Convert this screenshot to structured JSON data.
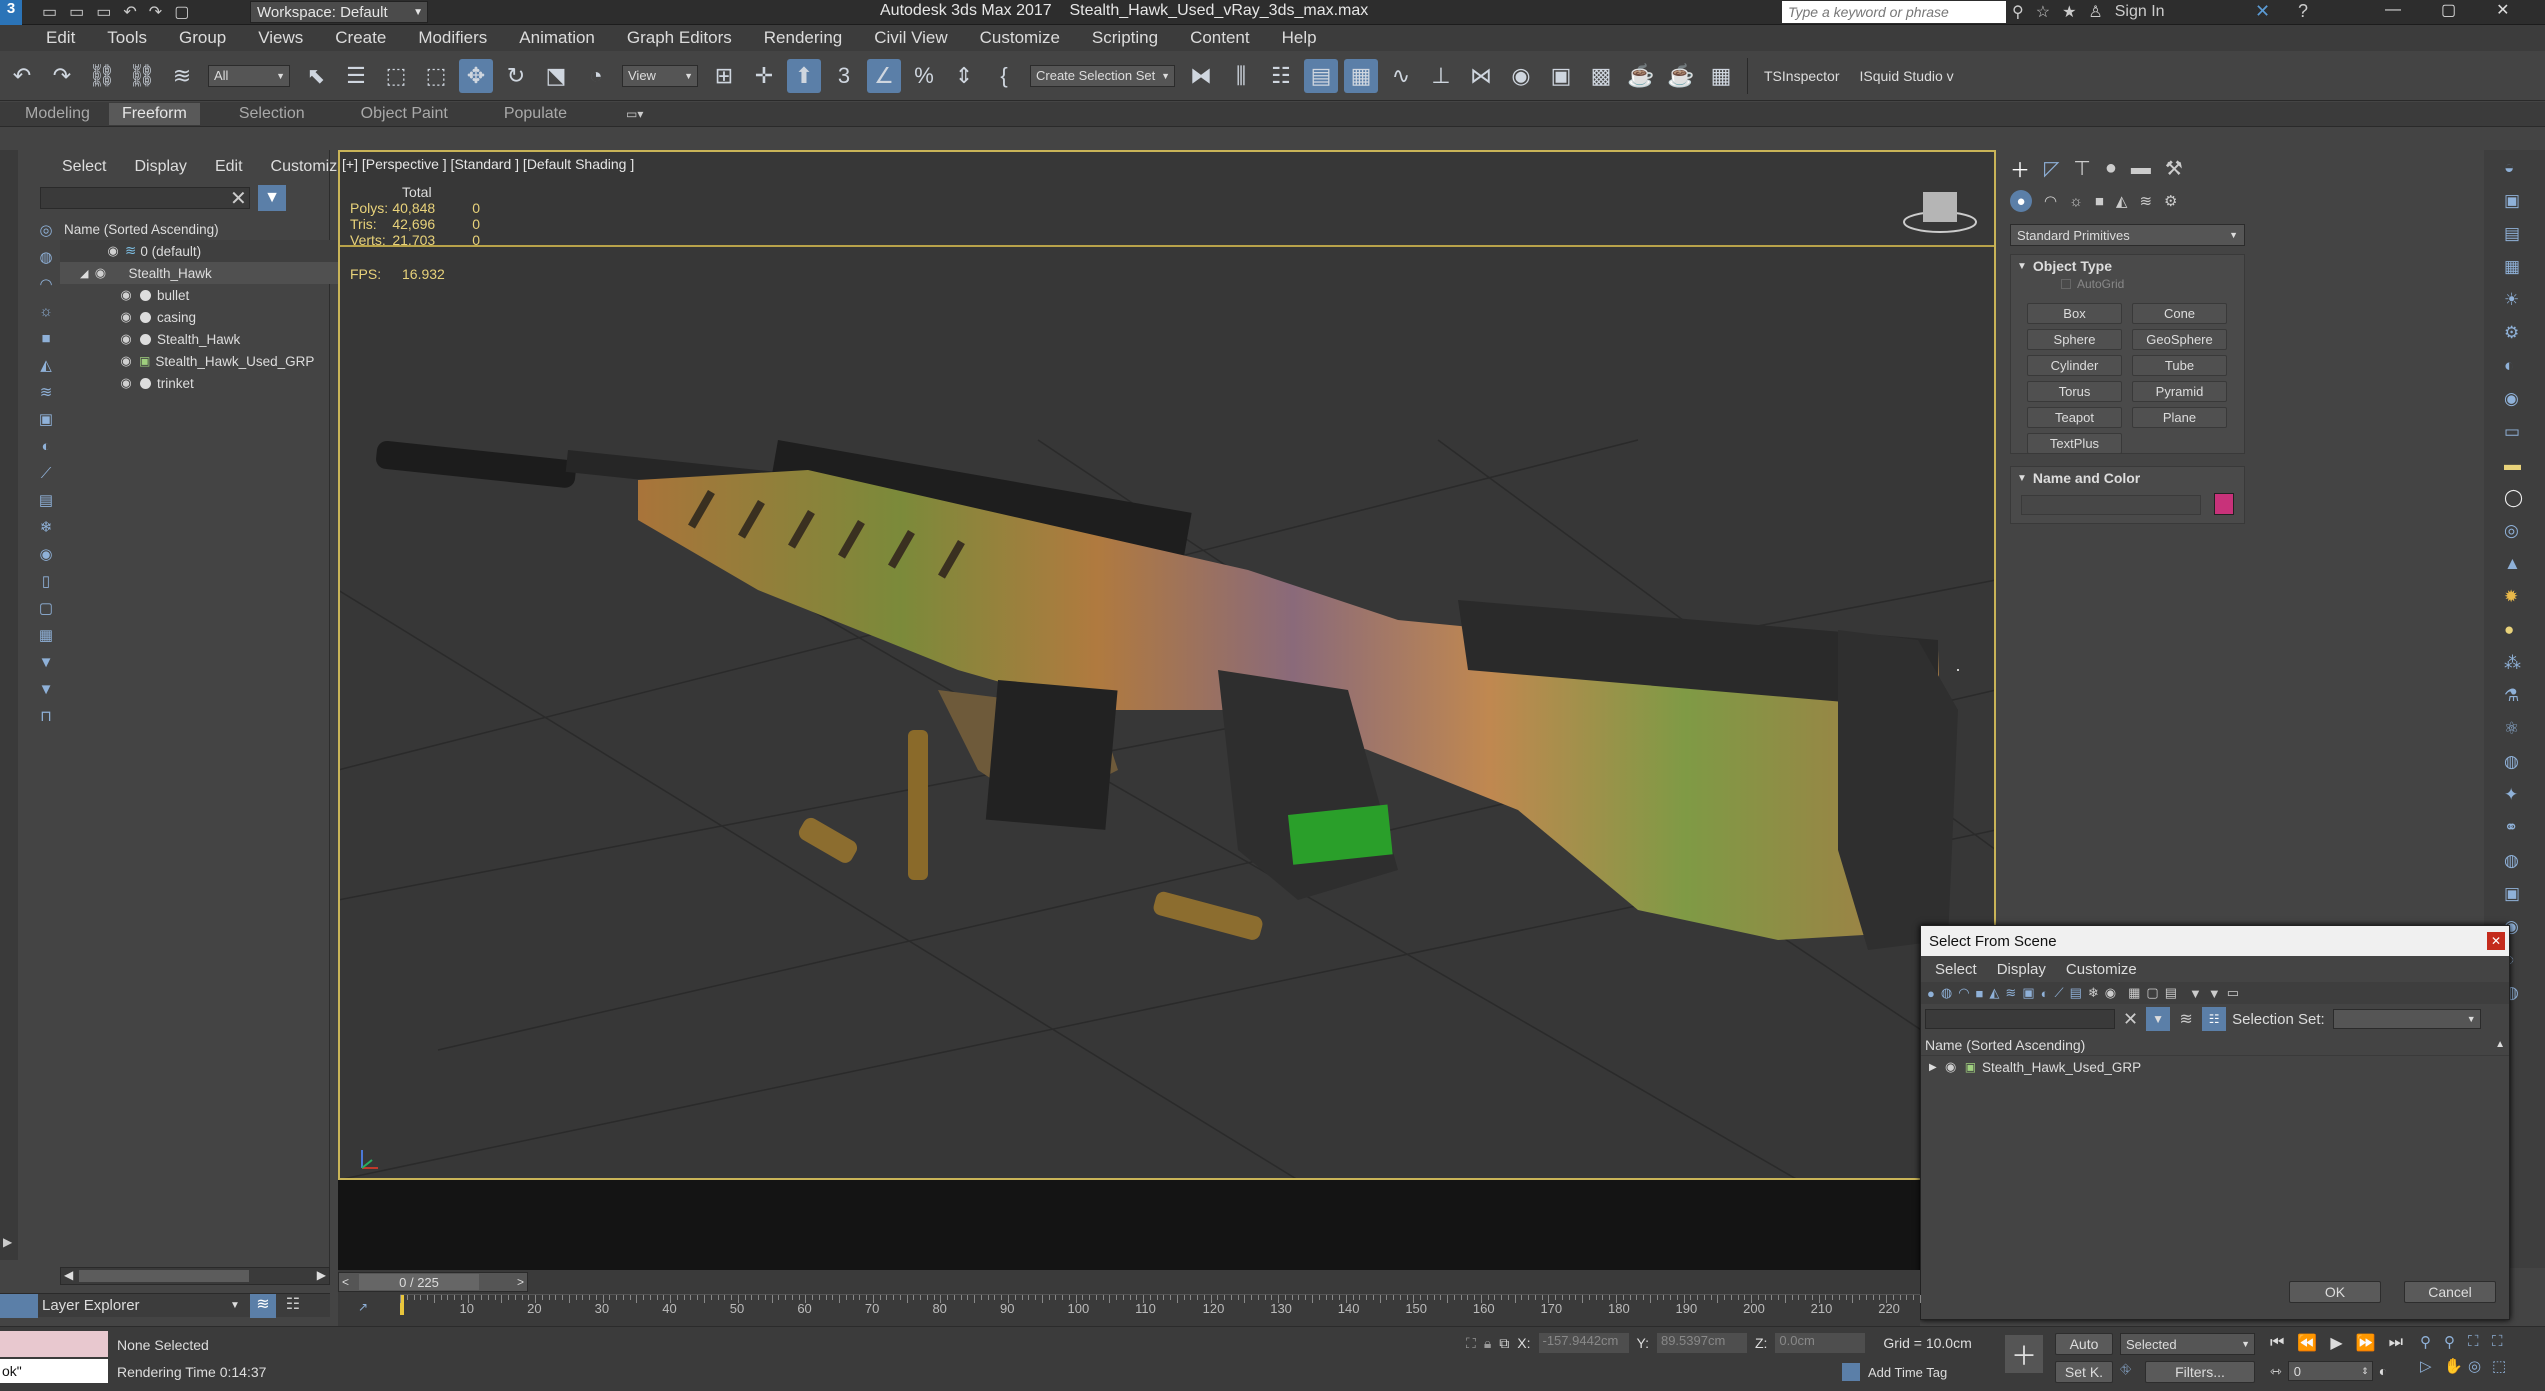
{
  "app": {
    "title": "Autodesk 3ds Max 2017",
    "file": "Stealth_Hawk_Used_vRay_3ds_max.max",
    "workspace": "Workspace: Default",
    "search_placeholder": "Type a keyword or phrase",
    "signin": "Sign In"
  },
  "menu": [
    "Edit",
    "Tools",
    "Group",
    "Views",
    "Create",
    "Modifiers",
    "Animation",
    "Graph Editors",
    "Rendering",
    "Civil View",
    "Customize",
    "Scripting",
    "Content",
    "Help"
  ],
  "toolbar": {
    "filter": "All",
    "ref_coord": "View",
    "selection_set": "Create Selection Set",
    "plugin1": "TSInspector",
    "plugin2": "ISquid Studio v"
  },
  "ribbon_tabs": [
    "Modeling",
    "Freeform",
    "Selection",
    "Object Paint",
    "Populate"
  ],
  "scene_explorer": {
    "menu": [
      "Select",
      "Display",
      "Edit",
      "Customize"
    ],
    "header": "Name (Sorted Ascending)",
    "rows": [
      "0 (default)",
      "Stealth_Hawk",
      "bullet",
      "casing",
      "Stealth_Hawk",
      "Stealth_Hawk_Used_GRP",
      "trinket"
    ],
    "footer": "Layer Explorer"
  },
  "viewport": {
    "label": "[+] [Perspective ] [Standard ] [Default Shading ]",
    "total": "Total",
    "polys_label": "Polys:",
    "polys": "40,848",
    "polys_sel": "0",
    "tris_label": "Tris:",
    "tris": "42,696",
    "tris_sel": "0",
    "verts_label": "Verts:",
    "verts": "21,703",
    "verts_sel": "0",
    "fps_label": "FPS:",
    "fps": "16.932"
  },
  "command_panel": {
    "dropdown": "Standard Primitives",
    "rollout1": "Object Type",
    "autogrid": "AutoGrid",
    "buttons": [
      "Box",
      "Cone",
      "Sphere",
      "GeoSphere",
      "Cylinder",
      "Tube",
      "Torus",
      "Pyramid",
      "Teapot",
      "Plane",
      "TextPlus"
    ],
    "rollout2": "Name and Color",
    "color": "#c8327a"
  },
  "dialog": {
    "title": "Select From Scene",
    "menu": [
      "Select",
      "Display",
      "Customize"
    ],
    "selection_set": "Selection Set:",
    "header": "Name (Sorted Ascending)",
    "item": "Stealth_Hawk_Used_GRP",
    "ok": "OK",
    "cancel": "Cancel"
  },
  "timeline": {
    "frame": "0 / 225",
    "ticks": [
      "10",
      "20",
      "30",
      "40",
      "50",
      "60",
      "70",
      "80",
      "90",
      "100",
      "110",
      "120",
      "130",
      "140",
      "150",
      "160",
      "170",
      "180",
      "190",
      "200",
      "210",
      "220"
    ]
  },
  "status": {
    "script": "ok\"",
    "selected": "None Selected",
    "render_time": "Rendering Time  0:14:37",
    "x_label": "X:",
    "x": "-157.9442cm",
    "y_label": "Y:",
    "y": "89.5397cm",
    "z_label": "Z:",
    "z": "0.0cm",
    "grid": "Grid = 10.0cm",
    "add_time_tag": "Add Time Tag",
    "auto": "Auto",
    "set_k": "Set K.",
    "key_mode": "Selected",
    "filters": "Filters...",
    "frame_field": "0"
  }
}
